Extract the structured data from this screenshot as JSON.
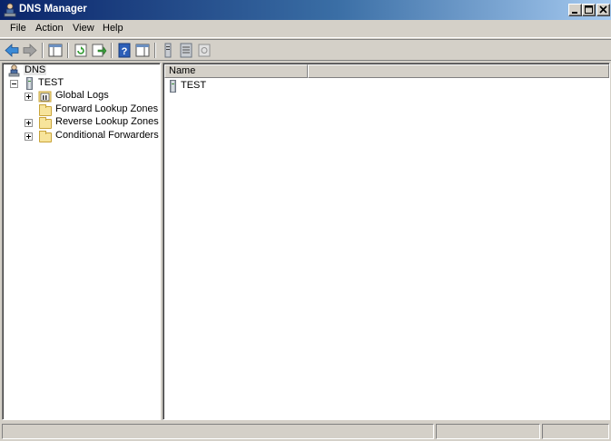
{
  "window": {
    "title": "DNS Manager"
  },
  "menu": {
    "items": [
      "File",
      "Action",
      "View",
      "Help"
    ]
  },
  "toolbar": {
    "buttons": [
      "back-icon",
      "forward-icon",
      "show-hide-tree-icon",
      "refresh-icon",
      "export-list-icon",
      "help-icon",
      "show-hide-action-pane-icon",
      "server-icon",
      "list-icon",
      "properties-icon"
    ]
  },
  "tree": {
    "root": "DNS",
    "server": "TEST",
    "children": [
      "Global Logs",
      "Forward Lookup Zones",
      "Reverse Lookup Zones",
      "Conditional Forwarders"
    ]
  },
  "list": {
    "columns": [
      "Name"
    ],
    "rows": [
      "TEST"
    ]
  }
}
